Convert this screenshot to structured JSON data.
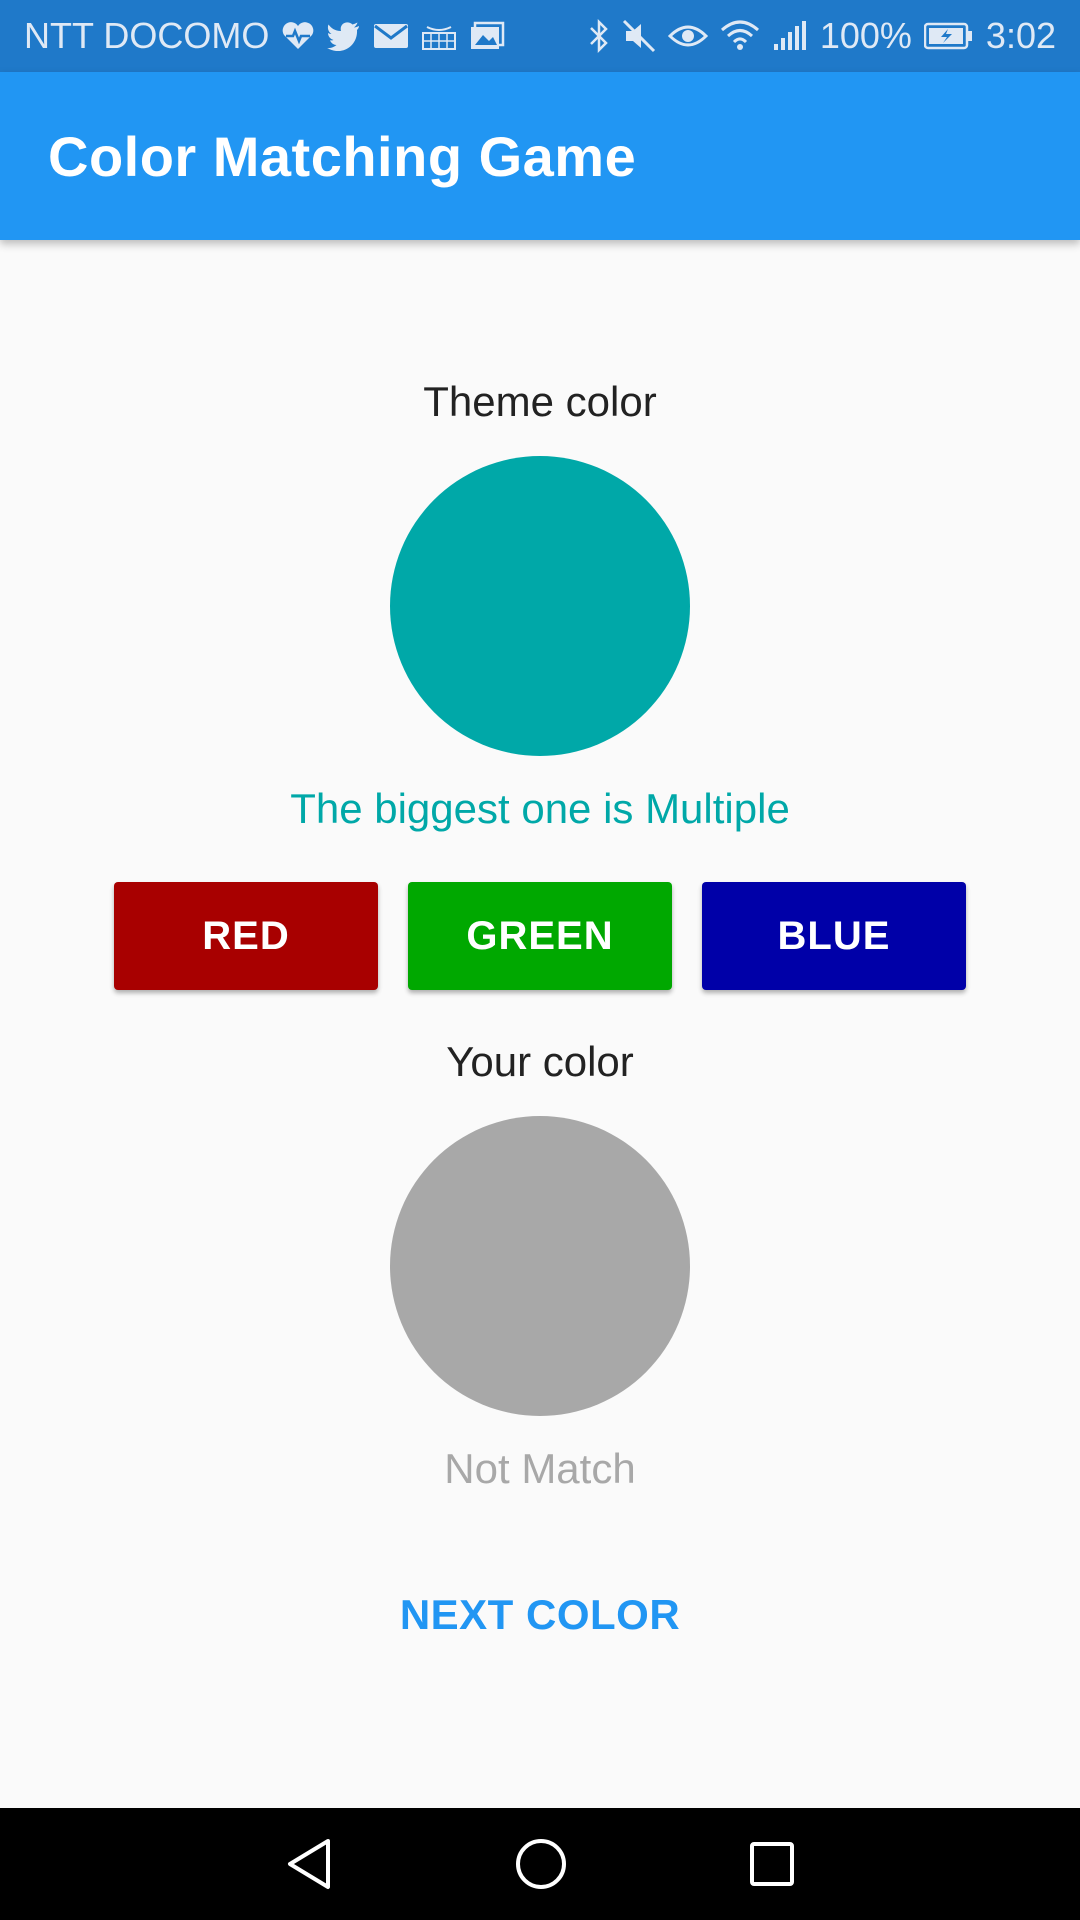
{
  "status_bar": {
    "carrier": "NTT DOCOMO",
    "battery": "100%",
    "time": "3:02",
    "icons_left": [
      "heart-pulse-icon",
      "twitter-icon",
      "mail-icon",
      "amazon-icon",
      "gallery-icon"
    ],
    "icons_right": [
      "bluetooth-icon",
      "mute-icon",
      "eye-icon",
      "wifi-icon",
      "signal-icon",
      "battery-icon"
    ]
  },
  "app_bar": {
    "title": "Color Matching Game"
  },
  "theme": {
    "label": "Theme color",
    "color": "#00a8a8",
    "hint": "The biggest one is Multiple"
  },
  "buttons": {
    "red": {
      "label": "RED",
      "color": "#a80000"
    },
    "green": {
      "label": "GREEN",
      "color": "#00a800"
    },
    "blue": {
      "label": "BLUE",
      "color": "#0000a8"
    }
  },
  "yours": {
    "label": "Your color",
    "color": "#a8a8a8",
    "status": "Not Match"
  },
  "next_button": {
    "label": "NEXT COLOR",
    "color": "#2196f3"
  },
  "nav_bar": {
    "icons": [
      "back-icon",
      "home-icon",
      "recents-icon"
    ]
  }
}
